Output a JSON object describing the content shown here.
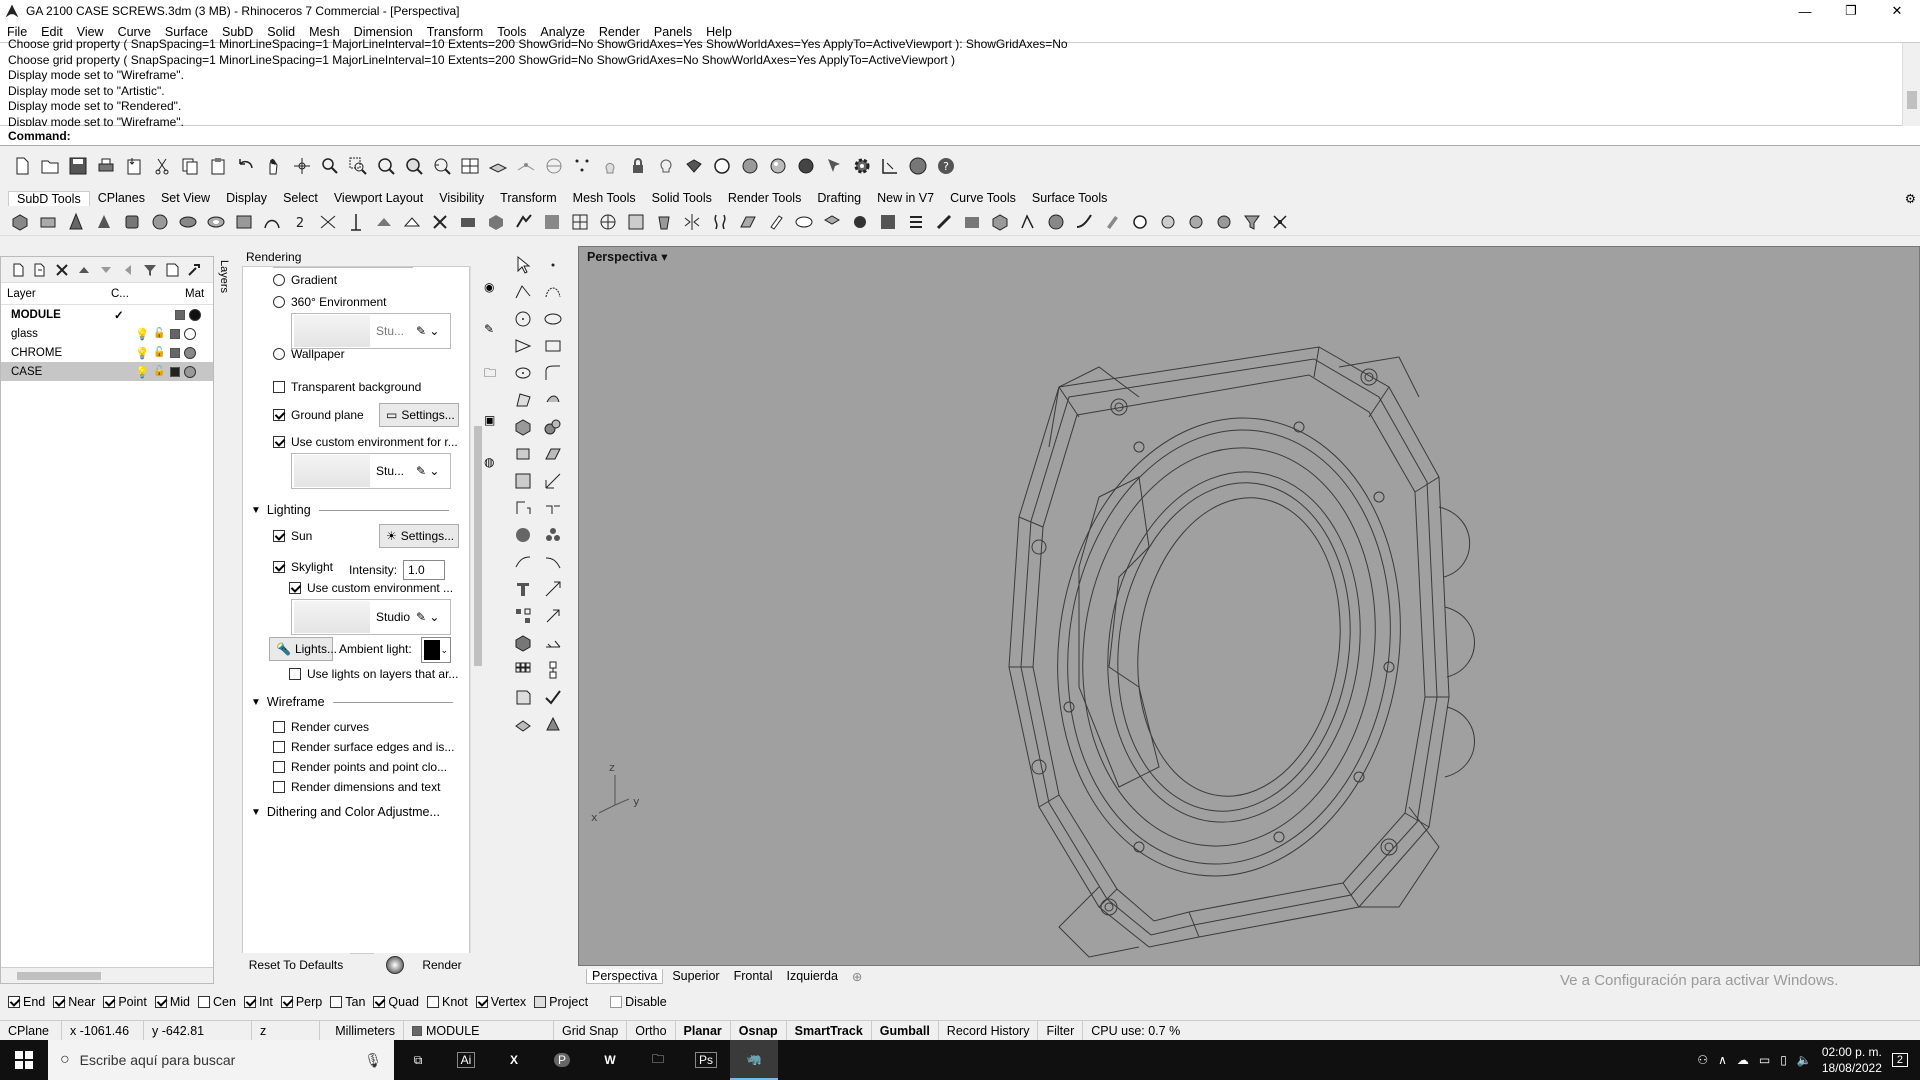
{
  "window": {
    "title": "GA 2100 CASE SCREWS.3dm (3 MB) - Rhinoceros 7 Commercial - [Perspectiva]",
    "minimize": "—",
    "restore": "❐",
    "close": "✕"
  },
  "menu": [
    "File",
    "Edit",
    "View",
    "Curve",
    "Surface",
    "SubD",
    "Solid",
    "Mesh",
    "Dimension",
    "Transform",
    "Tools",
    "Analyze",
    "Render",
    "Panels",
    "Help"
  ],
  "command_history": [
    "Choose grid property ( SnapSpacing=1  MinorLineSpacing=1  MajorLineInterval=10  Extents=200  ShowGrid=No  ShowGridAxes=Yes  ShowWorldAxes=Yes  ApplyTo=ActiveViewport ): ShowGridAxes=No",
    "Choose grid property ( SnapSpacing=1  MinorLineSpacing=1  MajorLineInterval=10  Extents=200  ShowGrid=No  ShowGridAxes=No  ShowWorldAxes=Yes  ApplyTo=ActiveViewport )",
    "Display mode set to \"Wireframe\".",
    "Display mode set to \"Artistic\".",
    "Display mode set to \"Rendered\".",
    "Display mode set to \"Wireframe\"."
  ],
  "command": {
    "label": "Command:",
    "value": ""
  },
  "toolbar_tabs": [
    "SubD Tools",
    "CPlanes",
    "Set View",
    "Display",
    "Select",
    "Viewport Layout",
    "Visibility",
    "Transform",
    "Mesh Tools",
    "Solid Tools",
    "Render Tools",
    "Drafting",
    "New in V7",
    "Curve Tools",
    "Surface Tools"
  ],
  "layers": {
    "vertical_tab": "Layers",
    "headers": {
      "layer": "Layer",
      "current": "C...",
      "material": "Mat"
    },
    "rows": [
      {
        "name": "MODULE",
        "current": "✓",
        "selected": false
      },
      {
        "name": "glass",
        "current": "",
        "selected": false
      },
      {
        "name": "CHROME",
        "current": "",
        "selected": false
      },
      {
        "name": "CASE",
        "current": "",
        "selected": true
      }
    ]
  },
  "rendering": {
    "title": "Rendering",
    "gradient": "Gradient",
    "env360": "360° Environment",
    "env360_name": "Stu...",
    "wallpaper": "Wallpaper",
    "transparent_bg": "Transparent background",
    "ground_plane": "Ground plane",
    "settings": "Settings...",
    "custom_env_reflections": "Use custom environment for r...",
    "custom_env_name": "Stu...",
    "lighting_header": "Lighting",
    "sun": "Sun",
    "skylight": "Skylight",
    "intensity_label": "Intensity:",
    "intensity_value": "1.0",
    "use_custom_env": "Use custom environment ...",
    "studio": "Studio",
    "lights_button": "Lights...",
    "ambient_light": "Ambient light:",
    "ambient_color": "#000000",
    "lights_on_layers": "Use lights on layers that ar...",
    "wireframe_header": "Wireframe",
    "render_curves": "Render curves",
    "render_edges": "Render surface edges and is...",
    "render_points": "Render points and point clo...",
    "render_dims": "Render dimensions and text",
    "dithering_header": "Dithering and Color Adjustme...",
    "reset_button": "Reset To Defaults",
    "render_button": "Render"
  },
  "viewport": {
    "label": "Perspectiva",
    "axis_x": "x",
    "axis_y": "y",
    "axis_z": "z",
    "watermark": "Ve a Configuración para activar Windows.",
    "tabs": [
      "Perspectiva",
      "Superior",
      "Frontal",
      "Izquierda"
    ],
    "add_tab": "⊕",
    "bg_color": "#a0a0a0"
  },
  "osnap": [
    {
      "label": "End",
      "checked": true
    },
    {
      "label": "Near",
      "checked": true
    },
    {
      "label": "Point",
      "checked": true
    },
    {
      "label": "Mid",
      "checked": true
    },
    {
      "label": "Cen",
      "checked": false
    },
    {
      "label": "Int",
      "checked": true
    },
    {
      "label": "Perp",
      "checked": true
    },
    {
      "label": "Tan",
      "checked": false
    },
    {
      "label": "Quad",
      "checked": true
    },
    {
      "label": "Knot",
      "checked": false
    },
    {
      "label": "Vertex",
      "checked": true
    },
    {
      "label": "Project",
      "checked": false
    },
    {
      "label": "Disable",
      "checked": false
    }
  ],
  "status": {
    "cplane": "CPlane",
    "x": "x -1061.46",
    "y": "y -642.81",
    "z": "z",
    "units": "Millimeters",
    "layer": "MODULE",
    "grid_snap": "Grid Snap",
    "ortho": "Ortho",
    "planar": "Planar",
    "osnap": "Osnap",
    "smarttrack": "SmartTrack",
    "gumball": "Gumball",
    "record_history": "Record History",
    "filter": "Filter",
    "cpu": "CPU use: 0.7 %"
  },
  "taskbar": {
    "search_placeholder": "Escribe aquí para buscar",
    "apps": [
      "Ai",
      "X",
      "P",
      "W",
      "",
      "Ps",
      ""
    ],
    "time": "02:00 p. m.",
    "date": "18/08/2022",
    "notifications": "2"
  }
}
